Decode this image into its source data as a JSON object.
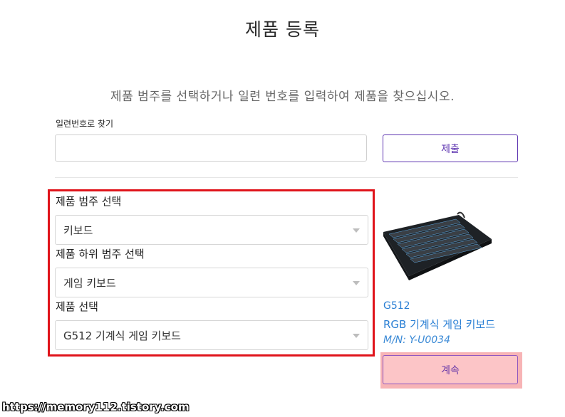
{
  "page": {
    "title": "제품 등록",
    "subtitle": "제품 범주를 선택하거나 일련 번호를 입력하여 제품을 찾으십시오."
  },
  "serial_search": {
    "label": "일련번호로 찾기",
    "value": "",
    "placeholder": "",
    "submit_label": "제출"
  },
  "category_selection": {
    "category": {
      "label": "제품 범주 선택",
      "selected": "키보드"
    },
    "subcategory": {
      "label": "제품 하위 범주 선택",
      "selected": "게임 키보드"
    },
    "product": {
      "label": "제품 선택",
      "selected": "G512 기계식 게임 키보드"
    }
  },
  "product_preview": {
    "image_icon": "keyboard-image",
    "model": "G512",
    "name": "RGB 기계식 게임 키보드",
    "model_number": "M/N: Y-U0034",
    "continue_label": "계속"
  },
  "watermark": "https://memory112.tistory.com",
  "colors": {
    "accent_purple": "#5e35b1",
    "link_blue": "#2a7fd4",
    "highlight_red": "#e0141b",
    "highlight_pink": "#f7b4b6"
  }
}
